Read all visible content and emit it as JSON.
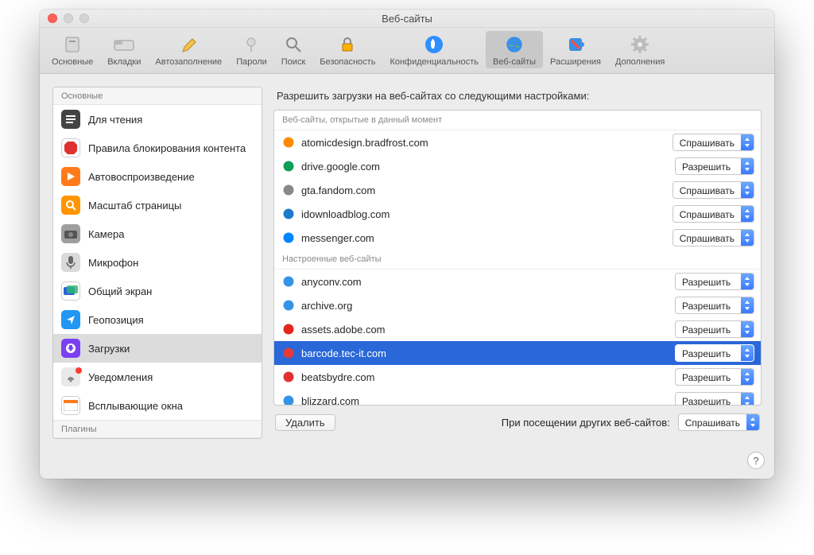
{
  "window": {
    "title": "Веб-сайты"
  },
  "toolbar": {
    "items": [
      {
        "label": "Основные"
      },
      {
        "label": "Вкладки"
      },
      {
        "label": "Автозаполнение"
      },
      {
        "label": "Пароли"
      },
      {
        "label": "Поиск"
      },
      {
        "label": "Безопасность"
      },
      {
        "label": "Конфиденциальность"
      },
      {
        "label": "Веб-сайты"
      },
      {
        "label": "Расширения"
      },
      {
        "label": "Дополнения"
      }
    ],
    "selected_index": 7
  },
  "sidebar": {
    "section_main": "Основные",
    "section_plugins": "Плагины",
    "items": [
      {
        "label": "Для чтения"
      },
      {
        "label": "Правила блокирования контента"
      },
      {
        "label": "Автовоспроизведение"
      },
      {
        "label": "Масштаб страницы"
      },
      {
        "label": "Камера"
      },
      {
        "label": "Микрофон"
      },
      {
        "label": "Общий экран"
      },
      {
        "label": "Геопозиция"
      },
      {
        "label": "Загрузки"
      },
      {
        "label": "Уведомления"
      },
      {
        "label": "Всплывающие окна"
      }
    ],
    "selected_index": 8,
    "badge_index": 9
  },
  "main": {
    "heading": "Разрешить загрузки на веб-сайтах со следующими настройками:",
    "open_sites_header": "Веб-сайты, открытые в данный момент",
    "configured_sites_header": "Настроенные веб-сайты",
    "open_sites": [
      {
        "domain": "atomicdesign.bradfrost.com",
        "action": "Спрашивать"
      },
      {
        "domain": "drive.google.com",
        "action": "Разрешить"
      },
      {
        "domain": "gta.fandom.com",
        "action": "Спрашивать"
      },
      {
        "domain": "idownloadblog.com",
        "action": "Спрашивать"
      },
      {
        "domain": "messenger.com",
        "action": "Спрашивать"
      }
    ],
    "configured_sites": [
      {
        "domain": "anyconv.com",
        "action": "Разрешить"
      },
      {
        "domain": "archive.org",
        "action": "Разрешить"
      },
      {
        "domain": "assets.adobe.com",
        "action": "Разрешить"
      },
      {
        "domain": "barcode.tec-it.com",
        "action": "Разрешить"
      },
      {
        "domain": "beatsbydre.com",
        "action": "Разрешить"
      },
      {
        "domain": "blizzard.com",
        "action": "Разрешить"
      }
    ],
    "configured_selected_index": 3,
    "delete_btn": "Удалить",
    "default_label": "При посещении других веб-сайтов:",
    "default_action": "Спрашивать"
  }
}
